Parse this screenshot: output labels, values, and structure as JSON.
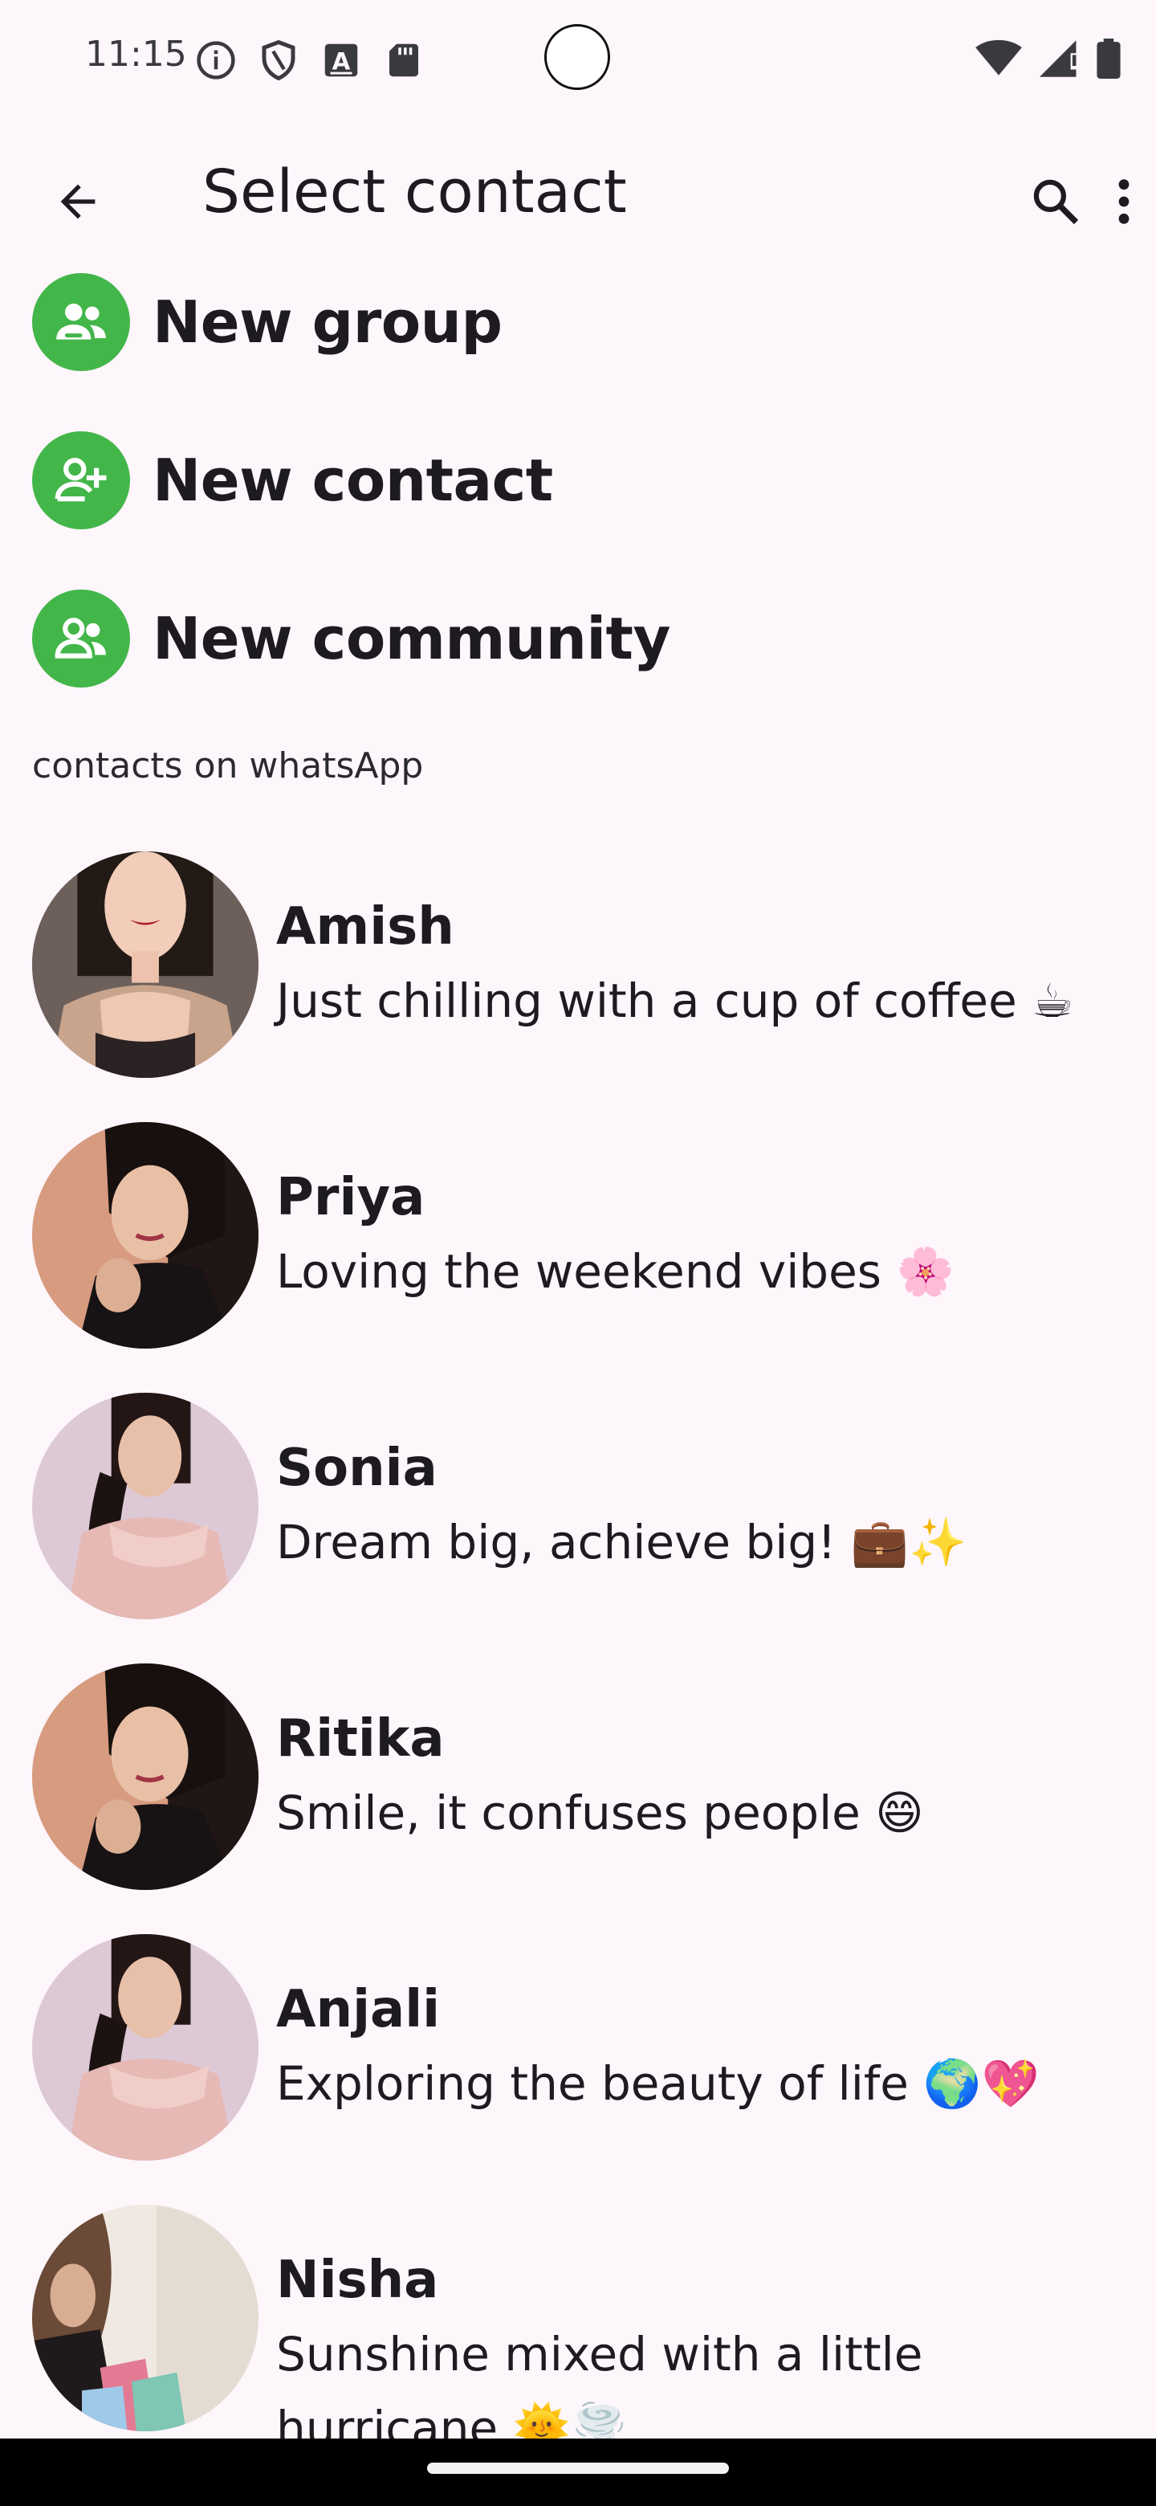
{
  "status_bar": {
    "time": "11:15",
    "left_icons": [
      "info-icon",
      "shield-icon",
      "font-a-icon",
      "sd-card-icon"
    ],
    "right_icons": [
      "wifi-icon",
      "signal-icon",
      "battery-icon"
    ]
  },
  "app_bar": {
    "title": "Select contact",
    "back_icon": "arrow-back-icon",
    "search_icon": "search-icon",
    "more_icon": "more-vert-icon"
  },
  "actions": [
    {
      "label": "New group",
      "icon": "group-icon"
    },
    {
      "label": "New contact",
      "icon": "add-person-icon"
    },
    {
      "label": "New community",
      "icon": "community-icon"
    }
  ],
  "section_title": "contacts on whatsApp",
  "contacts": [
    {
      "name": "Amish",
      "status": "Just chilling with a cup of coffee ☕"
    },
    {
      "name": "Priya",
      "status": "Loving the weekend vibes 🌸"
    },
    {
      "name": "Sonia",
      "status": "Dream big, achieve big! 💼✨"
    },
    {
      "name": "Ritika",
      "status": "Smile, it confuses people 😄"
    },
    {
      "name": "Anjali",
      "status": "Exploring the beauty of life 🌍💖"
    },
    {
      "name": "Nisha",
      "status": "Sunshine mixed with a little hurricane 🌞🌪️"
    }
  ],
  "colors": {
    "background": "#fdf6fb",
    "accent_green": "#43b649",
    "text": "#1d1b20"
  }
}
